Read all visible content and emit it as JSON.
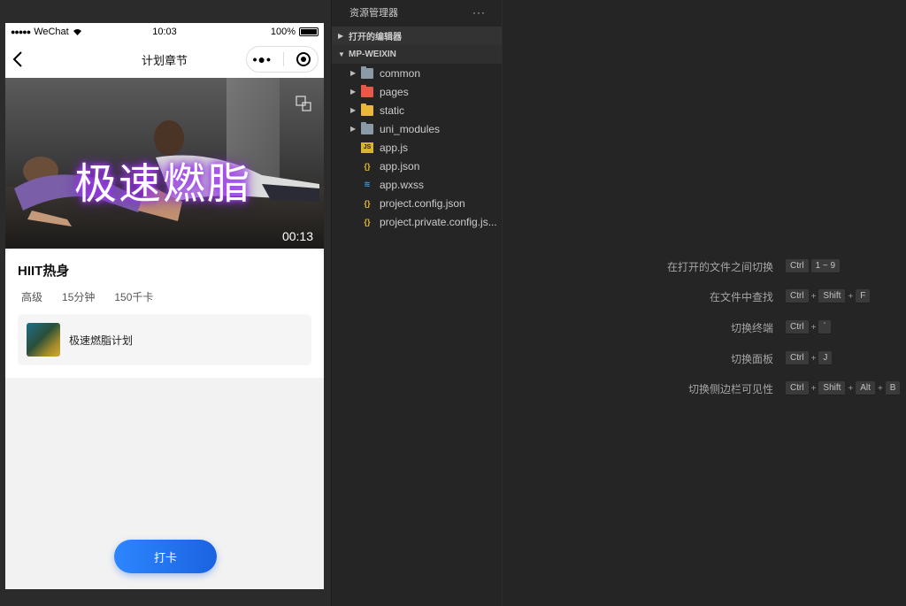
{
  "status_bar": {
    "carrier": "WeChat",
    "time": "10:03",
    "battery": "100%"
  },
  "nav_bar": {
    "title": "计划章节"
  },
  "video": {
    "overlay_title": "极速燃脂",
    "time": "00:13"
  },
  "card": {
    "title": "HIIT热身",
    "meta": [
      "高级",
      "15分钟",
      "150千卡"
    ],
    "plan_name": "极速燃脂计划"
  },
  "checkin_button": "打卡",
  "explorer": {
    "header": "资源管理器",
    "more": "···",
    "open_editors": "打开的编辑器",
    "project": "MP-WEIXIN",
    "items": [
      {
        "name": "common",
        "type": "folder",
        "icon": "folder-icon"
      },
      {
        "name": "pages",
        "type": "folder",
        "icon": "folder-pages-icon"
      },
      {
        "name": "static",
        "type": "folder",
        "icon": "folder-static-icon"
      },
      {
        "name": "uni_modules",
        "type": "folder",
        "icon": "folder-icon"
      },
      {
        "name": "app.js",
        "type": "file",
        "icon": "js-file-icon"
      },
      {
        "name": "app.json",
        "type": "file",
        "icon": "json-file-icon"
      },
      {
        "name": "app.wxss",
        "type": "file",
        "icon": "css-file-icon"
      },
      {
        "name": "project.config.json",
        "type": "file",
        "icon": "json-file-icon"
      },
      {
        "name": "project.private.config.js...",
        "type": "file",
        "icon": "json-file-icon"
      }
    ]
  },
  "shortcuts": [
    {
      "label": "在打开的文件之间切换",
      "keys": [
        "Ctrl",
        "1 ~ 9"
      ]
    },
    {
      "label": "在文件中查找",
      "keys": [
        "Ctrl",
        "Shift",
        "F"
      ]
    },
    {
      "label": "切换终端",
      "keys": [
        "Ctrl",
        "`"
      ]
    },
    {
      "label": "切换面板",
      "keys": [
        "Ctrl",
        "J"
      ]
    },
    {
      "label": "切换侧边栏可见性",
      "keys": [
        "Ctrl",
        "Shift",
        "Alt",
        "B"
      ]
    }
  ],
  "colors": {
    "accent": "#2d86ff",
    "sidebar_bg": "#252526",
    "video_glow": "#b044ff"
  }
}
